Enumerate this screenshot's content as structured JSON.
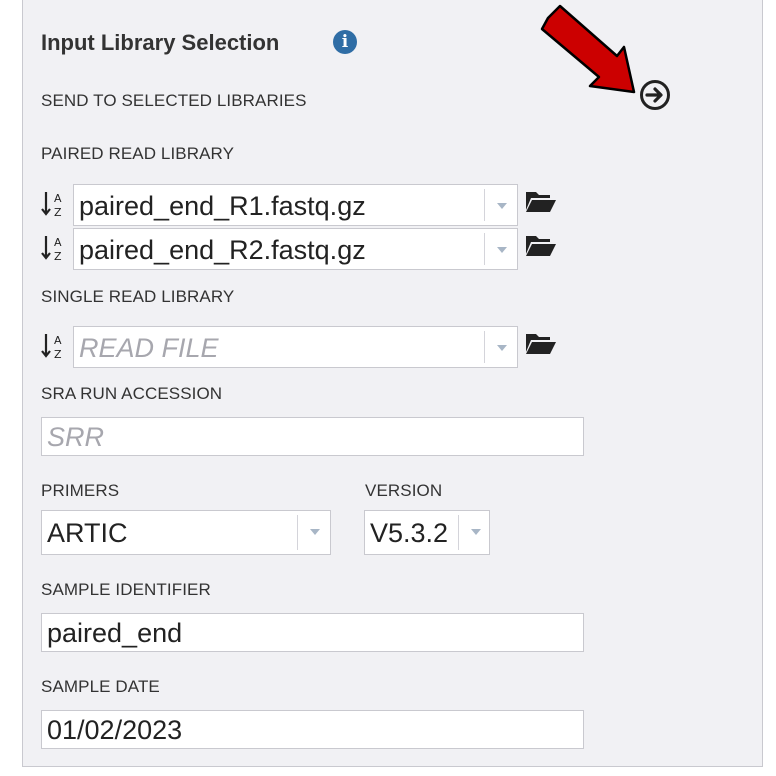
{
  "panel": {
    "title": "Input Library Selection",
    "send_label": "SEND TO SELECTED LIBRARIES",
    "paired_label": "PAIRED READ LIBRARY",
    "paired_files": [
      "paired_end_R1.fastq.gz",
      "paired_end_R2.fastq.gz"
    ],
    "single_label": "SINGLE READ LIBRARY",
    "single_placeholder": "READ FILE",
    "sra_label": "SRA RUN ACCESSION",
    "sra_placeholder": "SRR",
    "primers_label": "PRIMERS",
    "primers_value": "ARTIC",
    "version_label": "VERSION",
    "version_value": "V5.3.2",
    "sample_id_label": "SAMPLE IDENTIFIER",
    "sample_id_value": "paired_end",
    "sample_date_label": "SAMPLE DATE",
    "sample_date_value": "01/02/2023"
  },
  "icons": {
    "info": "info-icon",
    "send": "arrow-circle-right-icon",
    "sort": "sort-alpha-icon",
    "folder": "folder-open-icon",
    "annotation": "red-arrow-icon"
  },
  "colors": {
    "info_blue": "#2f6da5",
    "annotation_red": "#cc0000",
    "panel_bg": "#f1f1f4"
  }
}
